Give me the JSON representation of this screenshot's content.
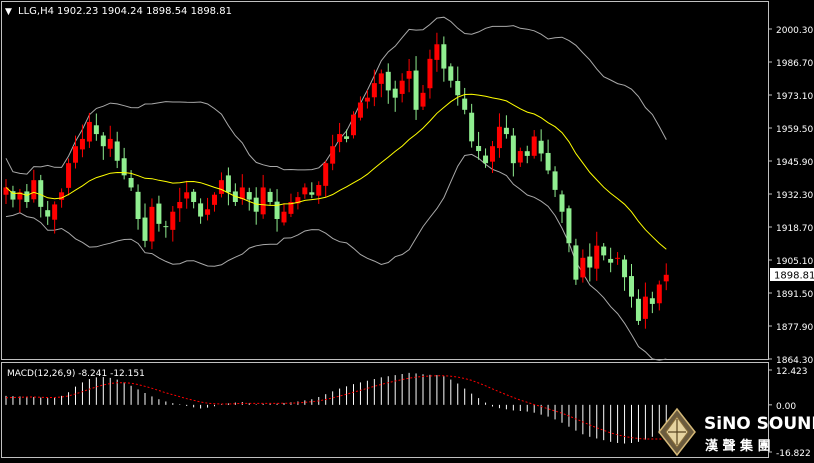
{
  "header": {
    "menu_glyph": "▼",
    "symbol_label": "LLG,H4",
    "ohlc_text": "1902.23 1904.24 1898.54 1898.81"
  },
  "price_axis": {
    "ticks": [
      "2000.30",
      "1986.70",
      "1973.10",
      "1959.50",
      "1945.90",
      "1932.30",
      "1918.70",
      "1905.10",
      "1891.50",
      "1877.90",
      "1864.30"
    ],
    "current_price": "1898.81"
  },
  "macd": {
    "label": "MACD(12,26,9) -8.241 -12.151",
    "axis_ticks": [
      "12.423",
      "0.00",
      "-16.822"
    ]
  },
  "brand": {
    "name_en": "SiNO SOUND",
    "name_cn": "漢 聲 集 團"
  },
  "colors": {
    "background": "#000000",
    "frame": "#c0c0c0",
    "axis_text": "#ffffff",
    "bull_candle": "#ff0000",
    "bear_candle": "#90ee90",
    "moving_average": "#ffff00",
    "bollinger": "#a9a9a9",
    "macd_hist": "#ffffff",
    "macd_signal": "#ff0000",
    "price_tag_bg": "#ffffff"
  },
  "chart_data": {
    "type": "candlestick",
    "timeframe": "H4",
    "y_range": [
      1864.3,
      2000.3
    ],
    "close_series": [
      1935,
      1930,
      1933,
      1929,
      1938,
      1927,
      1923,
      1928,
      1933,
      1945,
      1952,
      1955,
      1962,
      1957,
      1952,
      1955,
      1946,
      1940,
      1935,
      1922,
      1913,
      1927,
      1920,
      1919,
      1925,
      1929,
      1933,
      1929,
      1923,
      1926,
      1932,
      1938,
      1933,
      1929,
      1935,
      1930,
      1925,
      1935,
      1929,
      1922,
      1925,
      1929,
      1931,
      1935,
      1932,
      1936,
      1945,
      1952,
      1957,
      1955,
      1965,
      1970,
      1972,
      1978,
      1982,
      1975,
      1972,
      1979,
      1983,
      1967,
      1974,
      1988,
      1994,
      1984,
      1979,
      1973,
      1967,
      1954,
      1950,
      1945,
      1952,
      1960,
      1957,
      1945,
      1950,
      1948,
      1956,
      1949,
      1942,
      1934,
      1925,
      1912,
      1897,
      1906,
      1902,
      1911,
      1907,
      1904,
      1906,
      1898,
      1890,
      1880,
      1890,
      1887,
      1895,
      1899
    ],
    "macd": {
      "name": "MACD(12,26,9)",
      "main": -8.241,
      "signal": -12.151,
      "y_range": [
        -16.822,
        12.423
      ],
      "histogram": [
        3.2,
        3.1,
        3.0,
        2.9,
        2.8,
        2.6,
        2.4,
        2.6,
        3.2,
        4.5,
        6.5,
        8.0,
        9.2,
        9.8,
        9.9,
        9.6,
        9.0,
        8.0,
        6.8,
        5.5,
        4.2,
        3.0,
        2.0,
        1.2,
        0.6,
        0.2,
        -0.4,
        -0.9,
        -1.3,
        -1.0,
        -0.5,
        0.2,
        0.5,
        0.8,
        1.0,
        0.6,
        0.2,
        0.4,
        0.6,
        0.4,
        0.6,
        0.9,
        1.2,
        1.6,
        2.0,
        2.8,
        3.8,
        4.8,
        5.8,
        6.6,
        7.4,
        8.0,
        8.6,
        9.2,
        9.8,
        10.2,
        10.6,
        11.0,
        11.4,
        11.2,
        10.9,
        10.7,
        10.6,
        10.2,
        9.0,
        7.6,
        5.8,
        4.0,
        2.4,
        0.8,
        -0.6,
        -1.2,
        -1.6,
        -2.0,
        -2.2,
        -2.4,
        -2.8,
        -3.5,
        -4.2,
        -5.2,
        -6.4,
        -7.8,
        -9.2,
        -10.5,
        -11.4,
        -12.0,
        -12.6,
        -13.2,
        -13.6,
        -13.8,
        -13.6,
        -13.2,
        -12.4,
        -11.4,
        -10.2,
        -8.9
      ],
      "signal_series": [
        2.5,
        2.6,
        2.7,
        2.8,
        2.8,
        2.7,
        2.6,
        2.6,
        2.8,
        3.2,
        3.9,
        4.7,
        5.6,
        6.4,
        7.1,
        7.6,
        7.9,
        7.9,
        7.7,
        7.2,
        6.6,
        5.9,
        5.1,
        4.3,
        3.6,
        2.9,
        2.2,
        1.6,
        1.0,
        0.6,
        0.4,
        0.3,
        0.3,
        0.4,
        0.5,
        0.5,
        0.5,
        0.5,
        0.5,
        0.5,
        0.6,
        0.6,
        0.7,
        0.9,
        1.1,
        1.4,
        1.9,
        2.5,
        3.1,
        3.8,
        4.5,
        5.2,
        5.9,
        6.6,
        7.3,
        7.9,
        8.5,
        9.0,
        9.5,
        9.9,
        10.1,
        10.3,
        10.4,
        10.4,
        10.2,
        9.9,
        9.4,
        8.7,
        7.8,
        6.8,
        5.7,
        4.6,
        3.6,
        2.6,
        1.7,
        0.9,
        0.1,
        -0.6,
        -1.4,
        -2.2,
        -3.0,
        -4.0,
        -5.0,
        -6.1,
        -7.2,
        -8.2,
        -9.1,
        -10.0,
        -10.7,
        -11.3,
        -11.7,
        -12.0,
        -12.2,
        -12.2,
        -12.2,
        -12.15
      ]
    }
  }
}
